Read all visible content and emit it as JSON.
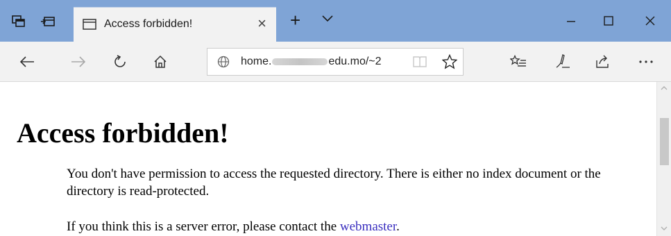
{
  "browser": {
    "tab": {
      "title": "Access forbidden!",
      "close_glyph": "×"
    },
    "new_tab_glyph": "+",
    "address": {
      "prefix": "home.",
      "suffix": "edu.mo/~2"
    },
    "icons": {
      "set_aside_tabs": "set-aside-tabs-icon",
      "tab_preview": "tab-preview-icon",
      "tab_page": "page-icon",
      "tab_list": "chevron-down-icon",
      "minimize": "minimize-icon",
      "maximize": "maximize-icon",
      "close": "close-icon",
      "back": "back-arrow-icon",
      "forward": "forward-arrow-icon",
      "refresh": "refresh-icon",
      "home": "home-icon",
      "site_info": "globe-icon",
      "reading_view": "book-icon",
      "favorite": "star-icon",
      "favorites_hub": "favorites-list-icon",
      "web_note": "pen-icon",
      "share": "share-icon",
      "more": "ellipsis-icon"
    },
    "colors": {
      "titlebar": "#7fa4d6",
      "toolbar": "#f2f2f2",
      "link": "#3a2fbf"
    }
  },
  "page": {
    "heading": "Access forbidden!",
    "paragraph1": "You don't have permission to access the requested directory. There is either no index document or the directory is read-protected.",
    "paragraph2_prefix": "If you think this is a server error, please contact the ",
    "paragraph2_link": "webmaster",
    "paragraph2_suffix": "."
  }
}
